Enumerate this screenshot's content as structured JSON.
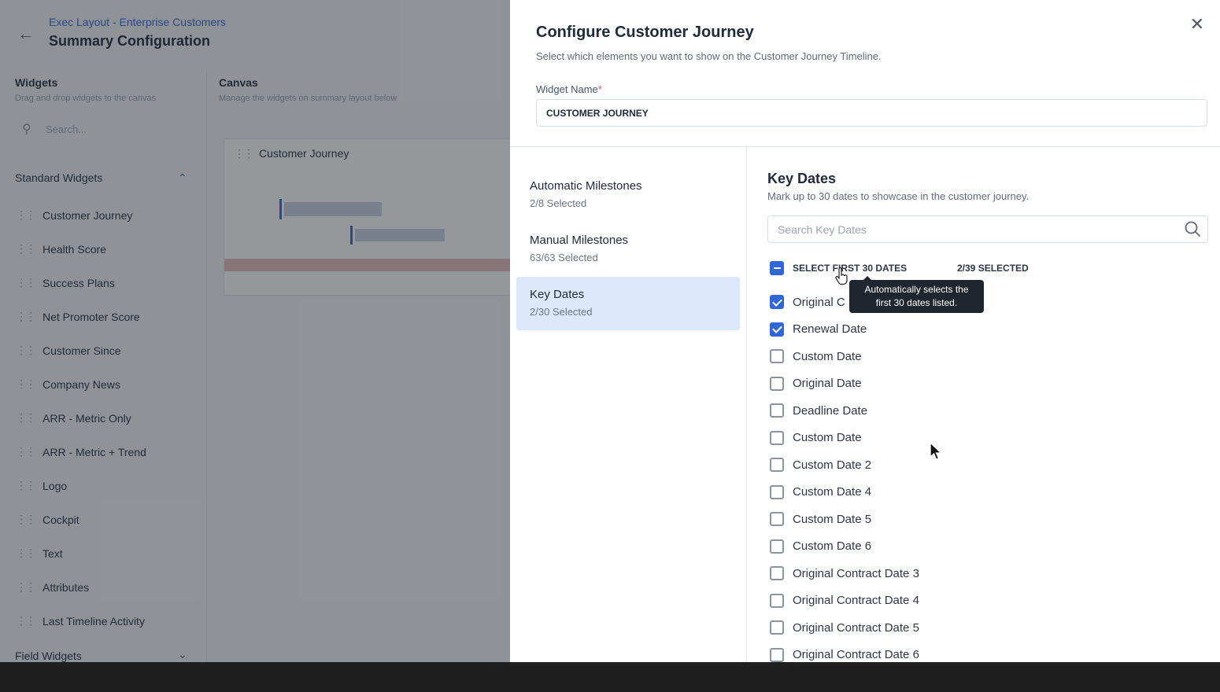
{
  "background": {
    "breadcrumb": "Exec Layout - Enterprise Customers",
    "title": "Summary Configuration",
    "widgets_heading": "Widgets",
    "widgets_subtitle": "Drag and drop widgets to the canvas",
    "canvas_heading": "Canvas",
    "canvas_subtitle": "Manage the widgets on summary layout below",
    "search_placeholder": "Search...",
    "standard_widgets_label": "Standard Widgets",
    "widgets": [
      "Customer Journey",
      "Health Score",
      "Success Plans",
      "Net Promoter Score",
      "Customer Since",
      "Company News",
      "ARR - Metric Only",
      "ARR - Metric + Trend",
      "Logo",
      "Cockpit",
      "Text",
      "Attributes",
      "Last Timeline Activity"
    ],
    "field_widgets_label": "Field Widgets",
    "canvas_card_title": "Customer Journey",
    "icons": {
      "back": "back-arrow-icon",
      "grip": "drag-handle-icon",
      "collapse": "chevron-up-icon",
      "expand": "chevron-down-icon"
    }
  },
  "modal": {
    "title": "Configure Customer Journey",
    "subtitle": "Select which elements you want to show on the Customer Journey Timeline.",
    "widget_name_label": "Widget Name",
    "required_mark": "*",
    "widget_name_value": "CUSTOMER JOURNEY",
    "close_icon": "close-icon",
    "categories": [
      {
        "label": "Automatic Milestones",
        "status": "2/8 Selected"
      },
      {
        "label": "Manual Milestones",
        "status": "63/63 Selected"
      },
      {
        "label": "Key Dates",
        "status": "2/30 Selected",
        "active": true
      }
    ],
    "key_dates": {
      "title": "Key Dates",
      "subtitle": "Mark up to 30 dates to showcase in the customer journey.",
      "search_placeholder": "Search Key Dates",
      "select_first_label": "SELECT FIRST 30 DATES",
      "selected_count": "2/39 SELECTED",
      "tooltip_line1": "Automatically selects the",
      "tooltip_line2": "first 30 dates listed.",
      "items": [
        {
          "label": "Original C",
          "checked": true
        },
        {
          "label": "Renewal Date",
          "checked": true
        },
        {
          "label": "Custom Date",
          "checked": false
        },
        {
          "label": "Original  Date",
          "checked": false
        },
        {
          "label": "Deadline Date",
          "checked": false
        },
        {
          "label": "Custom Date",
          "checked": false
        },
        {
          "label": "Custom Date 2",
          "checked": false
        },
        {
          "label": "Custom Date 4",
          "checked": false
        },
        {
          "label": "Custom Date 5",
          "checked": false
        },
        {
          "label": "Custom Date 6",
          "checked": false
        },
        {
          "label": "Original Contract Date 3",
          "checked": false
        },
        {
          "label": "Original Contract Date 4",
          "checked": false
        },
        {
          "label": "Original Contract Date 5",
          "checked": false
        },
        {
          "label": "Original Contract Date 6",
          "checked": false
        }
      ]
    }
  },
  "colors": {
    "accent": "#2f66d8",
    "active_category_bg": "#dce8fb",
    "overlay": "#191e26"
  }
}
